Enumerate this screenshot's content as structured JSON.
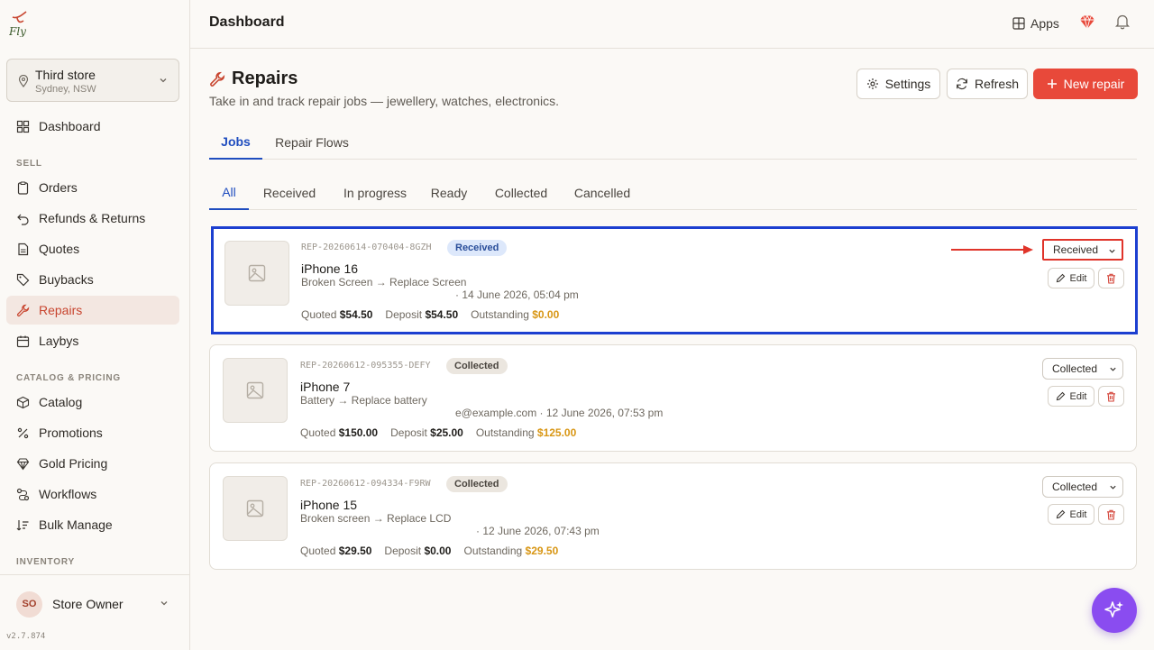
{
  "app": {
    "header_title": "Dashboard",
    "version": "v2.7.874"
  },
  "store": {
    "name": "Third store",
    "location": "Sydney, NSW"
  },
  "sidebar": {
    "items": [
      {
        "label": "Dashboard",
        "icon": "dashboard-icon"
      },
      {
        "label": "Orders",
        "icon": "clipboard-icon"
      },
      {
        "label": "Refunds & Returns",
        "icon": "undo-icon"
      },
      {
        "label": "Quotes",
        "icon": "document-icon"
      },
      {
        "label": "Buybacks",
        "icon": "tag-icon"
      },
      {
        "label": "Repairs",
        "icon": "wrench-icon",
        "active": true
      },
      {
        "label": "Laybys",
        "icon": "calendar-icon"
      },
      {
        "label": "Catalog",
        "icon": "box-icon"
      },
      {
        "label": "Promotions",
        "icon": "percent-icon"
      },
      {
        "label": "Gold Pricing",
        "icon": "gem-icon"
      },
      {
        "label": "Workflows",
        "icon": "workflow-icon"
      },
      {
        "label": "Bulk Manage",
        "icon": "bulk-icon"
      }
    ],
    "sections": {
      "sell": "SELL",
      "catalog": "CATALOG & PRICING",
      "inventory": "INVENTORY"
    }
  },
  "user": {
    "initials": "SO",
    "name": "Store Owner"
  },
  "topbar": {
    "apps_label": "Apps"
  },
  "page": {
    "title": "Repairs",
    "subtitle": "Take in and track repair jobs — jewellery, watches, electronics.",
    "settings_label": "Settings",
    "refresh_label": "Refresh",
    "new_label": "New repair"
  },
  "tabs": [
    "Jobs",
    "Repair Flows"
  ],
  "subtabs": [
    "All",
    "Received",
    "In progress",
    "Ready",
    "Collected",
    "Cancelled"
  ],
  "edit_label": "Edit",
  "money_labels": {
    "quoted": "Quoted",
    "deposit": "Deposit",
    "outstanding": "Outstanding"
  },
  "jobs": [
    {
      "ref": "REP-20260614-070404-8GZH",
      "status": "Received",
      "device": "iPhone 16",
      "issue": "Broken Screen → Replace Screen",
      "meta": "· 14 June 2026, 05:04 pm",
      "quoted": "$54.50",
      "deposit": "$54.50",
      "outstanding": "$0.00",
      "select_value": "Received"
    },
    {
      "ref": "REP-20260612-095355-DEFY",
      "status": "Collected",
      "device": "iPhone 7",
      "issue": "Battery → Replace battery",
      "meta": "e@example.com · 12 June 2026, 07:53 pm",
      "quoted": "$150.00",
      "deposit": "$25.00",
      "outstanding": "$125.00",
      "select_value": "Collected"
    },
    {
      "ref": "REP-20260612-094334-F9RW",
      "status": "Collected",
      "device": "iPhone 15",
      "issue": "Broken screen → Replace LCD",
      "meta": "· 12 June 2026, 07:43 pm",
      "quoted": "$29.50",
      "deposit": "$0.00",
      "outstanding": "$29.50",
      "select_value": "Collected"
    }
  ],
  "colors": {
    "accent": "#e8493a",
    "tab_active": "#1f4dbf",
    "highlight": "#1c3fd0",
    "outstanding": "#d89614",
    "fab": "#8a4cf0"
  }
}
